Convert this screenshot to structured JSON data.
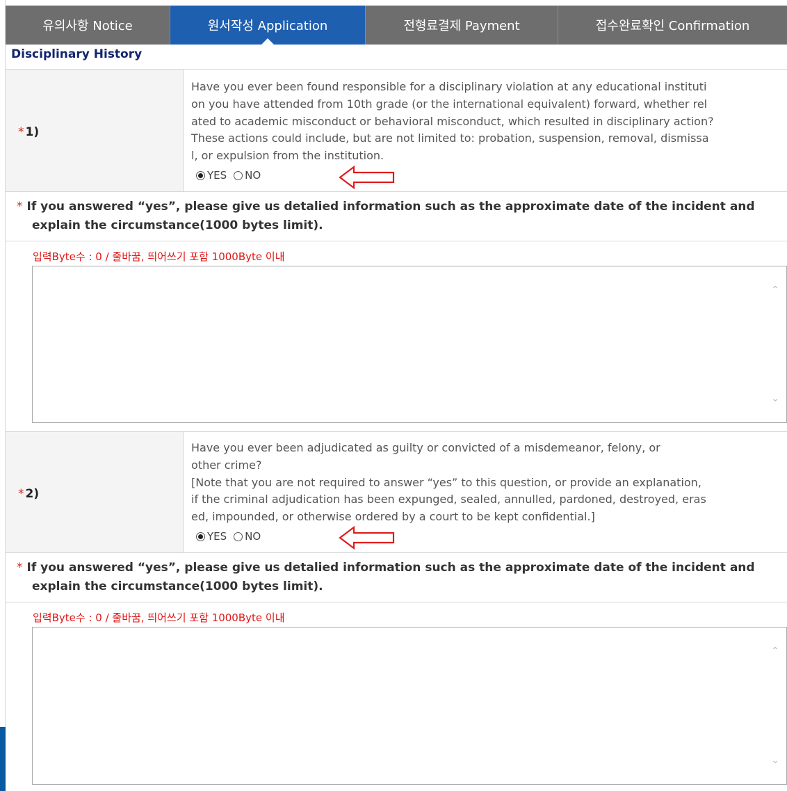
{
  "tabs": [
    {
      "label": "유의사항 Notice",
      "active": false
    },
    {
      "label": "원서작성 Application",
      "active": true
    },
    {
      "label": "전형료결제 Payment",
      "active": false
    },
    {
      "label": "접수완료확인 Confirmation",
      "active": false
    }
  ],
  "section_title": "Disciplinary History",
  "questions": [
    {
      "number": "1)",
      "required_mark": "*",
      "lines": [
        "Have you ever been found responsible for a disciplinary violation at any educational instituti",
        "on you have attended from 10th grade (or the international equivalent) forward, whether rel",
        "ated to academic misconduct or behavioral misconduct, which resulted in disciplinary action?",
        "These actions could include, but are not limited to: probation, suspension, removal, dismissa",
        "l, or expulsion from the institution."
      ],
      "yes_label": "YES",
      "no_label": "NO",
      "selected": "YES"
    },
    {
      "number": "2)",
      "required_mark": "*",
      "lines": [
        "Have you ever been adjudicated as guilty or convicted of a misdemeanor, felony, or",
        "other crime?",
        "[Note that you are not required to answer “yes” to this question, or provide an explanation,",
        "if the criminal adjudication has been expunged, sealed, annulled, pardoned, destroyed, eras",
        "ed, impounded, or otherwise ordered by a court to be kept confidential.]"
      ],
      "yes_label": "YES",
      "no_label": "NO",
      "selected": "YES"
    }
  ],
  "explain_note": {
    "star": "*",
    "line1": "If you answered “yes”, please give us detalied information such as the approximate date of the incident and",
    "line2": "explain the circumstance(1000 bytes limit)."
  },
  "byte_counter": "입력Byte수 : 0 / 줄바꿈, 띄어쓰기 포함 1000Byte 이내",
  "textareas": [
    {
      "value": ""
    },
    {
      "value": ""
    }
  ],
  "icons": {
    "scroll_up": "chevron-up-icon",
    "scroll_down": "chevron-down-icon",
    "annotation_arrow": "left-arrow-annotation-icon"
  },
  "colors": {
    "active_tab": "#1f5fb0",
    "inactive_tab": "#6e6e6e",
    "section_title": "#14256e",
    "required": "#d9261c",
    "byte_counter": "#e01515",
    "annotation_arrow": "#e11b1b"
  }
}
